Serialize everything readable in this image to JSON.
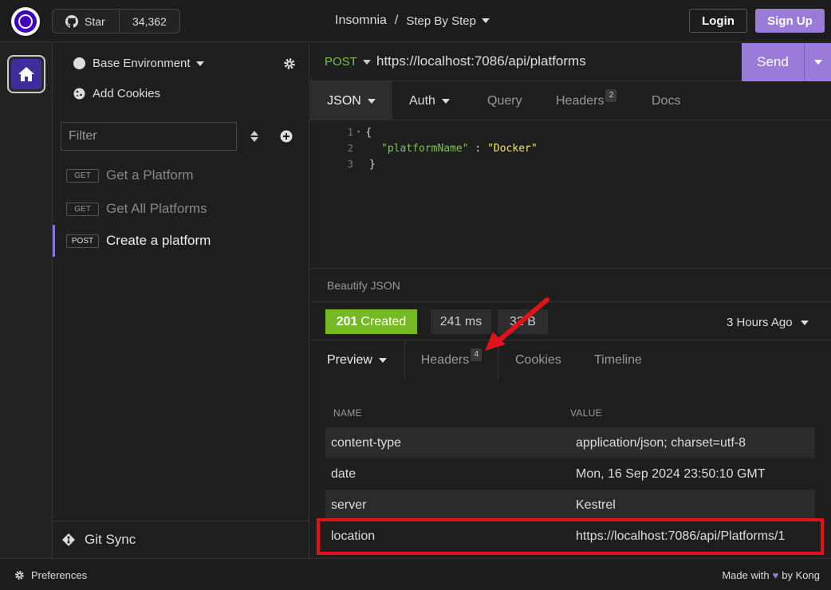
{
  "topbar": {
    "github_star_label": "Star",
    "github_star_count": "34,362",
    "app_name": "Insomnia",
    "separator": "/",
    "project": "Step By Step",
    "login_label": "Login",
    "signup_label": "Sign Up"
  },
  "sidebar": {
    "environment": "Base Environment",
    "add_cookies": "Add Cookies",
    "filter_placeholder": "Filter",
    "requests": [
      {
        "method": "GET",
        "name": "Get a Platform"
      },
      {
        "method": "GET",
        "name": "Get All Platforms"
      },
      {
        "method": "POST",
        "name": "Create a platform"
      }
    ],
    "git_sync": "Git Sync"
  },
  "request": {
    "method": "POST",
    "url": "https://localhost:7086/api/platforms",
    "send_label": "Send",
    "tabs": {
      "body": "JSON",
      "auth": "Auth",
      "query": "Query",
      "headers": "Headers",
      "headers_count": "2",
      "docs": "Docs"
    },
    "body_lines": [
      {
        "n": "1",
        "open": "{"
      },
      {
        "n": "2",
        "key": "\"platformName\"",
        "colon": " : ",
        "value": "\"Docker\""
      },
      {
        "n": "3",
        "close": "}"
      }
    ],
    "beautify": "Beautify JSON"
  },
  "response": {
    "status_code": "201",
    "status_text": "Created",
    "time": "241 ms",
    "size": "32 B",
    "time_ago": "3 Hours Ago",
    "tabs": {
      "preview": "Preview",
      "headers": "Headers",
      "headers_count": "4",
      "cookies": "Cookies",
      "timeline": "Timeline"
    },
    "headers_table": {
      "col_name": "NAME",
      "col_value": "VALUE",
      "rows": [
        {
          "name": "content-type",
          "value": "application/json; charset=utf-8"
        },
        {
          "name": "date",
          "value": "Mon, 16 Sep 2024 23:50:10 GMT"
        },
        {
          "name": "server",
          "value": "Kestrel"
        },
        {
          "name": "location",
          "value": "https://localhost:7086/api/Platforms/1"
        }
      ]
    }
  },
  "footer": {
    "preferences": "Preferences",
    "made_with": "Made with",
    "by": "by Kong"
  },
  "colors": {
    "accent": "#9a7bd9",
    "status_success": "#75ba24",
    "method_post": "#7ec34a",
    "highlight_box": "#e0121a"
  }
}
